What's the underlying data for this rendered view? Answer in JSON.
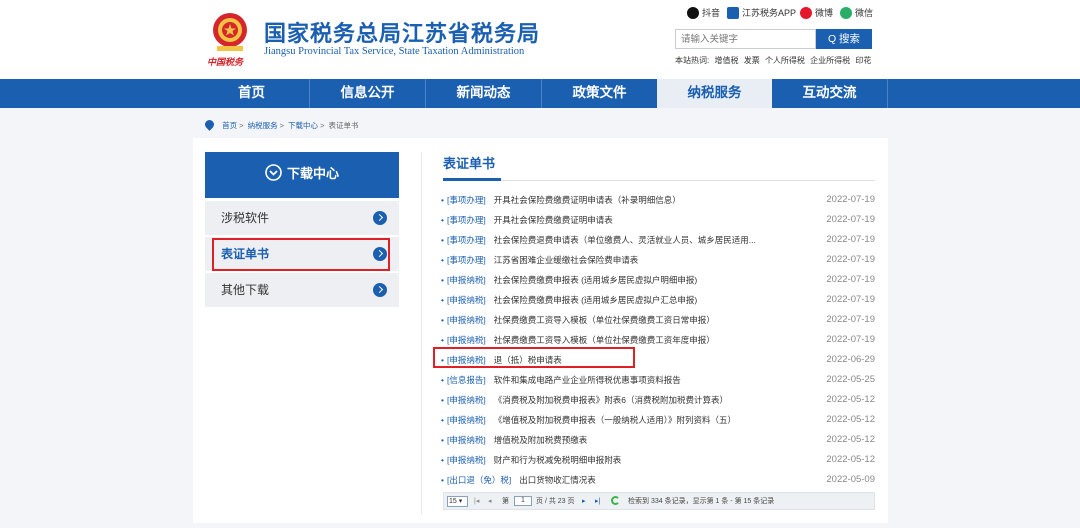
{
  "header": {
    "title": "国家税务总局江苏省税务局",
    "subtitle": "Jiangsu Provincial Tax Service, State Taxation Administration",
    "emblem_caption": "中国税务",
    "social": [
      {
        "label": "抖音",
        "icon": "douyin-icon",
        "color": "#111111"
      },
      {
        "label": "江苏税务APP",
        "icon": "app-icon",
        "color": "#1b5fb0"
      },
      {
        "label": "微博",
        "icon": "weibo-icon",
        "color": "#e6162d"
      },
      {
        "label": "微信",
        "icon": "wechat-icon",
        "color": "#2aae67"
      }
    ],
    "search": {
      "placeholder": "请输入关键字",
      "button": "Q 搜索"
    },
    "hot_label": "本站热词:",
    "hot_words": [
      "增值税",
      "发票",
      "个人所得税",
      "企业所得税",
      "印花"
    ]
  },
  "nav": {
    "items": [
      "首页",
      "信息公开",
      "新闻动态",
      "政策文件",
      "纳税服务",
      "互动交流"
    ],
    "active_index": 4
  },
  "breadcrumb": [
    "首页",
    "纳税服务",
    "下载中心",
    "表证单书"
  ],
  "sidebar": {
    "heading": "下载中心",
    "items": [
      {
        "label": "涉税软件"
      },
      {
        "label": "表证单书"
      },
      {
        "label": "其他下载"
      }
    ],
    "active_index": 1
  },
  "list": {
    "title": "表证单书",
    "rows": [
      {
        "category": "[事项办理]",
        "title": "开具社会保险费缴费证明申请表（补录明细信息）",
        "date": "2022-07-19"
      },
      {
        "category": "[事项办理]",
        "title": "开具社会保险费缴费证明申请表",
        "date": "2022-07-19"
      },
      {
        "category": "[事项办理]",
        "title": "社会保险费退费申请表（单位缴费人、灵活就业人员、城乡居民适用...",
        "date": "2022-07-19"
      },
      {
        "category": "[事项办理]",
        "title": "江苏省困难企业缓缴社会保险费申请表",
        "date": "2022-07-19"
      },
      {
        "category": "[申报纳税]",
        "title": "社会保险费缴费申报表 (适用城乡居民虚拟户明细申报)",
        "date": "2022-07-19"
      },
      {
        "category": "[申报纳税]",
        "title": "社会保险费缴费申报表 (适用城乡居民虚拟户汇总申报)",
        "date": "2022-07-19"
      },
      {
        "category": "[申报纳税]",
        "title": "社保费缴费工资导入模板（单位社保费缴费工资日常申报）",
        "date": "2022-07-19"
      },
      {
        "category": "[申报纳税]",
        "title": "社保费缴费工资导入模板（单位社保费缴费工资年度申报）",
        "date": "2022-07-19"
      },
      {
        "category": "[申报纳税]",
        "title": "退（抵）税申请表",
        "date": "2022-06-29"
      },
      {
        "category": "[信息报告]",
        "title": "软件和集成电路产业企业所得税优惠事项资料报告",
        "date": "2022-05-25"
      },
      {
        "category": "[申报纳税]",
        "title": "《消费税及附加税费申报表》附表6（消费税附加税费计算表）",
        "date": "2022-05-12"
      },
      {
        "category": "[申报纳税]",
        "title": "《增值税及附加税费申报表（一般纳税人适用）》附列资料（五）",
        "date": "2022-05-12"
      },
      {
        "category": "[申报纳税]",
        "title": "增值税及附加税费预缴表",
        "date": "2022-05-12"
      },
      {
        "category": "[申报纳税]",
        "title": "财产和行为税减免税明细申报附表",
        "date": "2022-05-12"
      },
      {
        "category": "[出口退（免）税]",
        "title": "出口货物收汇情况表",
        "date": "2022-05-09"
      }
    ]
  },
  "pager": {
    "page_size": "15",
    "page_label": "第",
    "current_page": "1",
    "total_text": "页 / 共 23 页",
    "summary": "检索到 334 条记录，显示第 1 条 - 第 15 条记录"
  },
  "colors": {
    "primary": "#1b5fb0",
    "highlight": "#e02027"
  }
}
